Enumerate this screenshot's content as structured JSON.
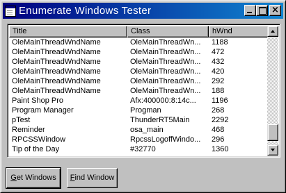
{
  "window": {
    "title": "Enumerate Windows Tester",
    "icon": "app-window-icon",
    "caption_buttons": [
      "minimize-icon",
      "maximize-icon",
      "close-icon"
    ],
    "close_glyph": "×"
  },
  "listview": {
    "columns": [
      "Title",
      "Class",
      "hWnd"
    ],
    "rows": [
      {
        "title": "OleMainThreadWndName",
        "class": "OleMainThreadWn...",
        "hwnd": "1188"
      },
      {
        "title": "OleMainThreadWndName",
        "class": "OleMainThreadWn...",
        "hwnd": "472"
      },
      {
        "title": "OleMainThreadWndName",
        "class": "OleMainThreadWn...",
        "hwnd": "432"
      },
      {
        "title": "OleMainThreadWndName",
        "class": "OleMainThreadWn...",
        "hwnd": "420"
      },
      {
        "title": "OleMainThreadWndName",
        "class": "OleMainThreadWn...",
        "hwnd": "292"
      },
      {
        "title": "OleMainThreadWndName",
        "class": "OleMainThreadWn...",
        "hwnd": "188"
      },
      {
        "title": "Paint Shop Pro",
        "class": "Afx:400000:8:14c...",
        "hwnd": "1196"
      },
      {
        "title": "Program Manager",
        "class": "Progman",
        "hwnd": "268"
      },
      {
        "title": "pTest",
        "class": "ThunderRT5Main",
        "hwnd": "2292"
      },
      {
        "title": "Reminder",
        "class": "osa_main",
        "hwnd": "468"
      },
      {
        "title": "RPCSSWindow",
        "class": "RpcssLogoffWindo...",
        "hwnd": "296"
      },
      {
        "title": "Tip of the Day",
        "class": "#32770",
        "hwnd": "1360"
      }
    ],
    "scroll_position": 0.93
  },
  "buttons": {
    "get_accel": "G",
    "get_rest": "et Windows",
    "find_accel": "F",
    "find_rest": "ind Window"
  }
}
